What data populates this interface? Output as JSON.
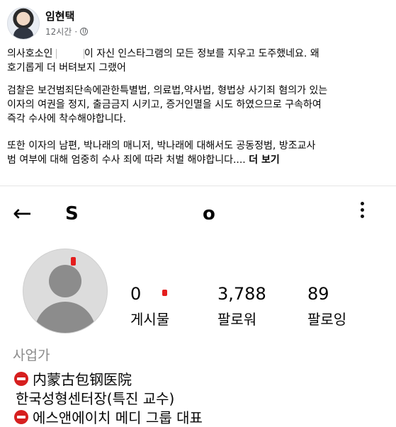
{
  "post": {
    "author": "임현택",
    "time": "12시간",
    "dot": "·",
    "paragraph1": "의사호소인 [redacted]이 자신 인스타그램의 모든 정보를 지우고 도주했네요. 왜\n호기롭게 더 버텨보지 그랬어",
    "paragraph1_prefix": "의사호소인 ",
    "paragraph1_suffix": "이 자신 인스타그램의 모든 정보를 지우고 도주했네요. 왜\n호기롭게 더 버텨보지 그랬어",
    "paragraph2": "검찰은 보건범죄단속에관한특별법, 의료법,약사법, 형법상 사기죄 혐의가 있는\n이자의 여권을 정지, 출금금지 시키고, 증거인멸을 시도 하였으므로 구속하여\n즉각 수사에 착수해야합니다.",
    "paragraph3": "또한 이자의 남편, 박나래의 매니저, 박나래에  대해서도  공동정범, 방조교사\n범 여부에 대해 엄중히 수사 죄에 따라 처벌 해야합니다.... ",
    "see_more": "더 보기"
  },
  "instagram": {
    "username_left": "S",
    "username_right": "o",
    "stats": [
      {
        "value": "0",
        "label": "게시물"
      },
      {
        "value": "3,788",
        "label": "팔로워"
      },
      {
        "value": "89",
        "label": "팔로잉"
      }
    ],
    "category": "사업가",
    "bio": [
      "内蒙古包钢医院",
      "한국성형센터장(특진 교수)",
      "에스앤에이치 메디 그룹 대표"
    ],
    "colors": {
      "redact_mark": "#e41e1e",
      "stop_icon": "#d61f1f"
    }
  }
}
